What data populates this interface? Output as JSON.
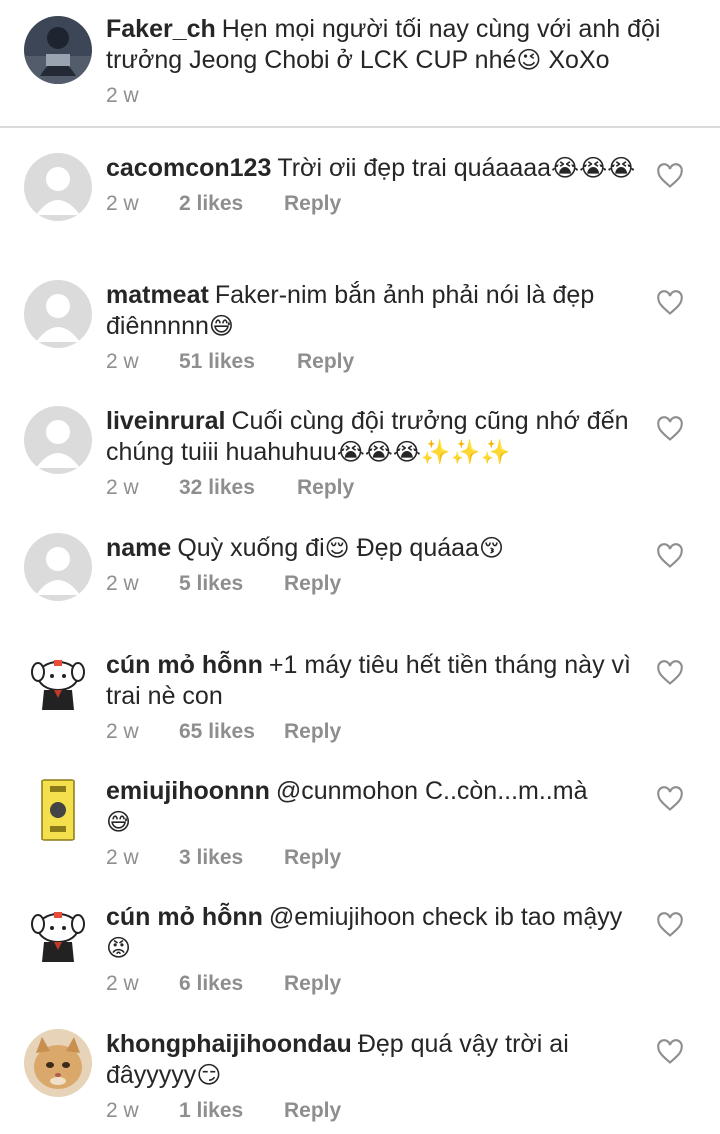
{
  "post": {
    "username": "Faker_ch",
    "caption": "Hẹn mọi người tối nay cùng với anh đội trưởng Jeong Chobi ở LCK CUP nhé",
    "caption_emoji": "😉",
    "caption_tail": " XoXo",
    "time": "2 w"
  },
  "comments": [
    {
      "username": "cacomcon123",
      "text": "Trời ơii đẹp trai quáaaaa",
      "emoji": "😭😭😭",
      "time": "2 w",
      "likes": "2 likes",
      "reply": "Reply",
      "avatar": "generic"
    },
    {
      "username": "matmeat",
      "text": "Faker-nim bắn ảnh phải nói là đẹp điênnnnn",
      "emoji": "😅",
      "time": "2 w",
      "likes": "51 likes",
      "reply": "Reply",
      "avatar": "generic"
    },
    {
      "username": "liveinrural",
      "text": "Cuối cùng đội trưởng cũng nhớ đến chúng tuiii huahuhuu",
      "emoji": "😭😭😭✨✨✨",
      "time": "2 w",
      "likes": "32 likes",
      "reply": "Reply",
      "avatar": "generic"
    },
    {
      "username": "name",
      "text": "Quỳ xuống đi",
      "emoji": "😌",
      "text2": " Đẹp quáaa",
      "emoji2": "😚",
      "time": "2 w",
      "likes": "5 likes",
      "reply": "Reply",
      "avatar": "generic"
    },
    {
      "username": "cún mỏ hỗnn",
      "text": "+1 máy tiêu hết tiền tháng này vì trai nè con",
      "emoji": "",
      "time": "2 w",
      "likes": "65 likes",
      "reply": "Reply",
      "avatar": "doodle-dog"
    },
    {
      "username": "emiujihoonnn",
      "text": "@cunmohon C..còn...m..mà",
      "emoji": "😅",
      "time": "2 w",
      "likes": "3 likes",
      "reply": "Reply",
      "avatar": "yellow-card"
    },
    {
      "username": "cún mỏ hỗnn",
      "text": "@emiujihoon check ib tao mậyy",
      "emoji": "😡",
      "time": "2 w",
      "likes": "6 likes",
      "reply": "Reply",
      "avatar": "doodle-dog"
    },
    {
      "username": "khongphaijihoondau",
      "text": "Đẹp quá vậy trời ai đâyyyyy",
      "emoji": "😏",
      "time": "2 w",
      "likes": "1 likes",
      "reply": "Reply",
      "avatar": "cat"
    }
  ],
  "colors": {
    "text": "#262626",
    "muted": "#8e8e8e",
    "divider": "#dbdbdb",
    "avatar_generic": "#dbdbdb"
  }
}
